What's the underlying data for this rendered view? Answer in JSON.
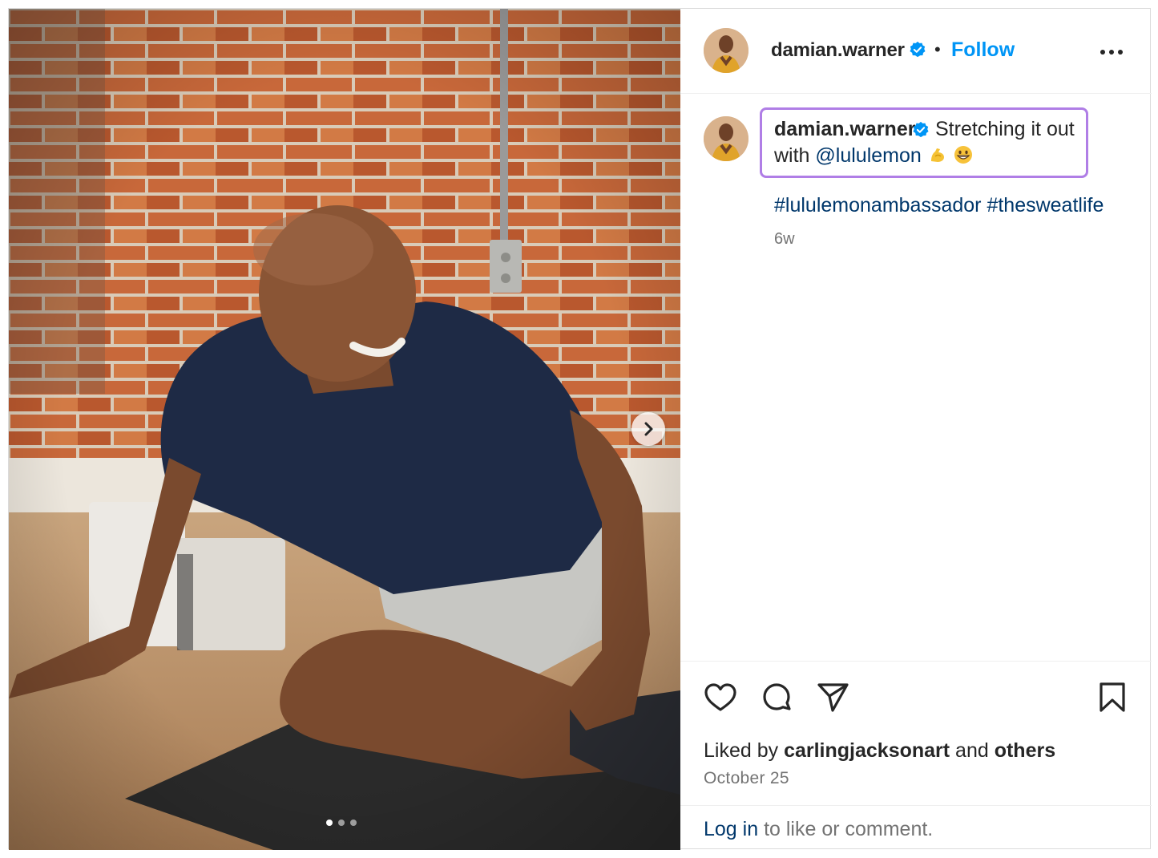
{
  "post": {
    "author": {
      "username": "damian.warner",
      "verified": true,
      "follow_label": "Follow"
    },
    "caption": {
      "username": "damian.warner",
      "text_line1": "Stretching it out",
      "text_with": "with ",
      "mention": "@lululemon",
      "emojis": [
        "flexed-biceps",
        "grinning-face"
      ]
    },
    "hashtags": [
      "#lululemonambassador",
      "#thesweatlife"
    ],
    "time_ago": "6w",
    "likes": {
      "prefix": "Liked by ",
      "user": "carlingjacksonart",
      "middle": " and ",
      "others": "others"
    },
    "date": "October 25",
    "login_prompt": {
      "link": "Log in",
      "text": " to like or comment."
    },
    "carousel": {
      "slides": 3,
      "active_index": 0
    }
  },
  "icons": {
    "like": "heart-icon",
    "comment": "comment-icon",
    "share": "share-icon",
    "save": "bookmark-icon",
    "more": "more-options-icon",
    "next": "chevron-right-icon",
    "verified": "verified-badge-icon"
  },
  "colors": {
    "link": "#0095f6",
    "mention": "#00376b",
    "highlight": "#b07ee6",
    "verified": "#0095f6"
  }
}
